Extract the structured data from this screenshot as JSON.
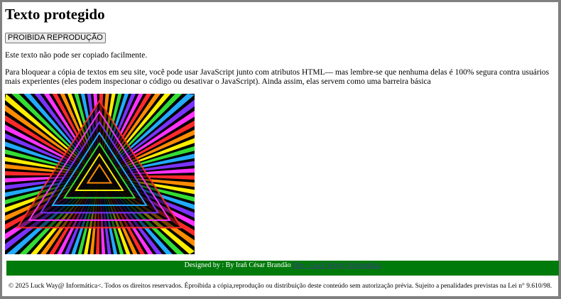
{
  "page": {
    "title": "Texto protegido",
    "button_label": "PROIBIDA REPRODUÇÃO",
    "paragraph1": "Este texto não pode ser copiado facilmente.",
    "paragraph2": "Para bloquear a cópia de textos em seu site, você pode usar JavaScript junto com atributos HTML— mas lembre-se que nenhuma delas é 100% segura contra usuários mais experientes (eles podem inspecionar o código ou desativar o JavaScript). Ainda assim, elas servem como uma barreira básica"
  },
  "image": {
    "description_icon": "psychedelic-triangle-tunnel-image"
  },
  "footer": {
    "designed_by": "Designed by : By Irañ César Brandão",
    "link": "Dev - Luck Way@ Informática",
    "copyright": "© 2025 Luck Way@ Informática<. Todos os direitos reservados. Éproibida a cópia,reprodução ou distribuição deste conteúdo sem autorização prévia. Sujeito a penalidades previstas na Lei n° 9.610/98.",
    "bar_color": "#007a0a"
  }
}
